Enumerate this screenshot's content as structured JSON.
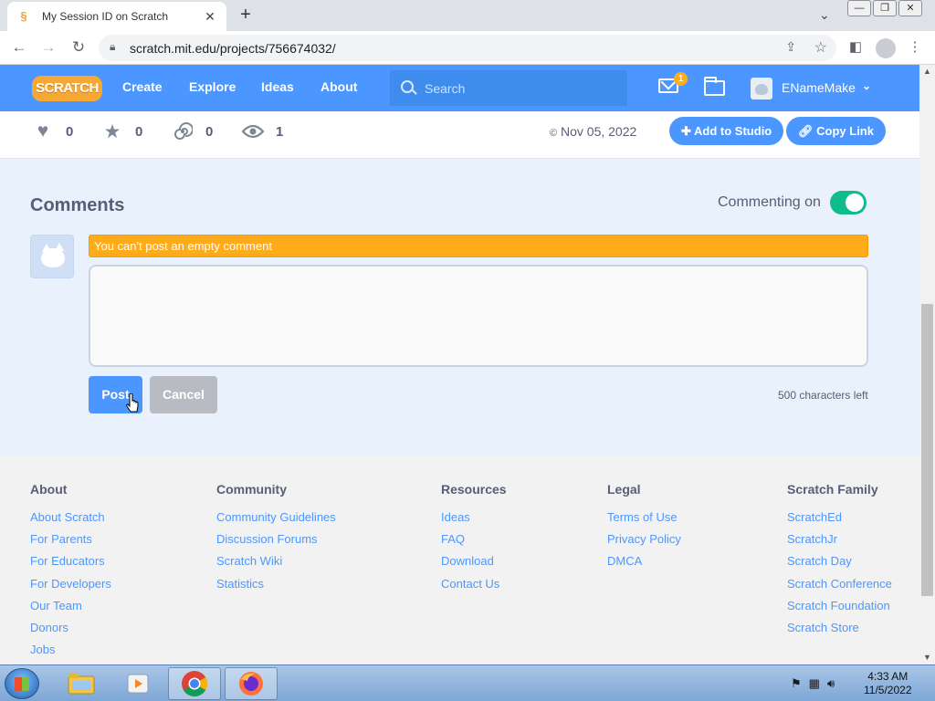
{
  "browser": {
    "tab_title": "My Session ID on Scratch",
    "url": "scratch.mit.edu/projects/756674032/"
  },
  "nav": {
    "logo": "SCRATCH",
    "links": [
      "Create",
      "Explore",
      "Ideas",
      "About"
    ],
    "search_placeholder": "Search",
    "message_count": "1",
    "username": "ENameMake"
  },
  "stats": {
    "loves": "0",
    "favorites": "0",
    "remixes": "0",
    "views": "1",
    "date": "Nov 05, 2022",
    "add_to_studio": "Add to Studio",
    "copy_link": "Copy Link"
  },
  "comments": {
    "title": "Comments",
    "commenting_label": "Commenting on",
    "commenting_enabled": true,
    "error": "You can't post an empty comment",
    "input_value": "",
    "post": "Post",
    "cancel": "Cancel",
    "chars_left": "500 characters left"
  },
  "footer": {
    "columns": [
      {
        "title": "About",
        "links": [
          "About Scratch",
          "For Parents",
          "For Educators",
          "For Developers",
          "Our Team",
          "Donors",
          "Jobs"
        ]
      },
      {
        "title": "Community",
        "links": [
          "Community Guidelines",
          "Discussion Forums",
          "Scratch Wiki",
          "Statistics"
        ]
      },
      {
        "title": "Resources",
        "links": [
          "Ideas",
          "FAQ",
          "Download",
          "Contact Us"
        ]
      },
      {
        "title": "Legal",
        "links": [
          "Terms of Use",
          "Privacy Policy",
          "DMCA"
        ]
      },
      {
        "title": "Scratch Family",
        "links": [
          "ScratchEd",
          "ScratchJr",
          "Scratch Day",
          "Scratch Conference",
          "Scratch Foundation",
          "Scratch Store"
        ]
      }
    ]
  },
  "taskbar": {
    "time": "4:33 AM",
    "date": "11/5/2022"
  },
  "colors": {
    "scratch_blue": "#4c97ff",
    "warning_orange": "#ffab1a",
    "toggle_green": "#0fbd8c"
  }
}
